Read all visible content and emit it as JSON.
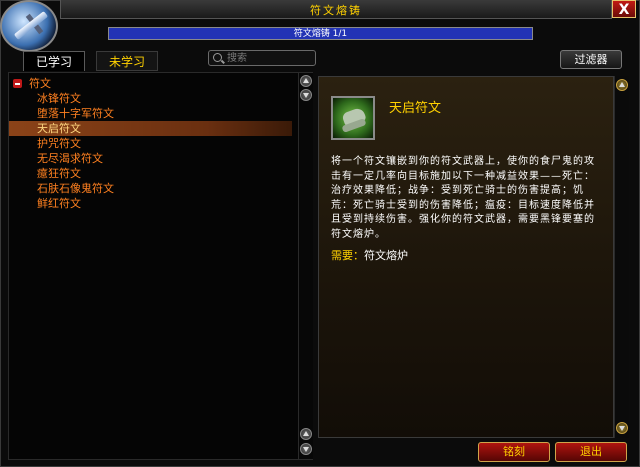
{
  "window": {
    "title": "符文熔铸",
    "close_label": "X"
  },
  "progress": {
    "text": "符文熔铸 1/1",
    "fraction": 1.0
  },
  "tabs": [
    {
      "label": "已学习",
      "active": true
    },
    {
      "label": "未学习",
      "active": false
    }
  ],
  "search": {
    "placeholder": "搜索",
    "value": ""
  },
  "filter_label": "过滤器",
  "category": {
    "label": "符文",
    "expanded": true
  },
  "list_items": [
    {
      "label": "冰锋符文"
    },
    {
      "label": "堕落十字军符文"
    },
    {
      "label": "天启符文",
      "selected": true
    },
    {
      "label": "护咒符文"
    },
    {
      "label": "无尽渴求符文"
    },
    {
      "label": "癔狂符文"
    },
    {
      "label": "石肤石像鬼符文"
    },
    {
      "label": "鲜红符文"
    }
  ],
  "detail": {
    "icon": "clawed-hand-icon",
    "name": "天启符文",
    "description": "将一个符文镶嵌到你的符文武器上，使你的食尸鬼的攻击有一定几率向目标施加以下一种减益效果——死亡：治疗效果降低；战争：受到死亡骑士的伤害提高；饥荒：死亡骑士受到的伤害降低；瘟疫：目标速度降低并且受到持续伤害。强化你的符文武器，需要黑锋要塞的符文熔炉。",
    "requirement_label": "需要：",
    "requirement_value": "符文熔炉"
  },
  "buttons": {
    "engrave": "铭刻",
    "exit": "退出"
  },
  "colors": {
    "list_text": "#ff8020",
    "gold": "#ffd100",
    "selected_row": "#8b4318",
    "button_red": "#b0140f"
  }
}
